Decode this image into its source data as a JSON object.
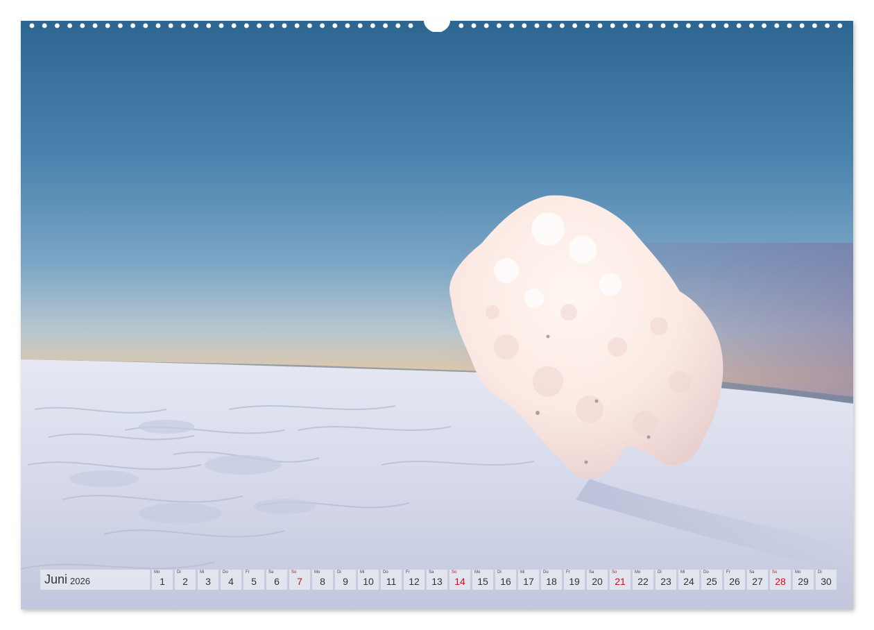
{
  "calendar": {
    "month": "Juni",
    "year": "2026",
    "sunday_color": "#c0111b",
    "days": [
      {
        "abbr": "Mo",
        "num": "1",
        "sunday": false
      },
      {
        "abbr": "Di",
        "num": "2",
        "sunday": false
      },
      {
        "abbr": "Mi",
        "num": "3",
        "sunday": false
      },
      {
        "abbr": "Do",
        "num": "4",
        "sunday": false
      },
      {
        "abbr": "Fr",
        "num": "5",
        "sunday": false
      },
      {
        "abbr": "Sa",
        "num": "6",
        "sunday": false
      },
      {
        "abbr": "So",
        "num": "7",
        "sunday": true
      },
      {
        "abbr": "Mo",
        "num": "8",
        "sunday": false
      },
      {
        "abbr": "Di",
        "num": "9",
        "sunday": false
      },
      {
        "abbr": "Mi",
        "num": "10",
        "sunday": false
      },
      {
        "abbr": "Do",
        "num": "11",
        "sunday": false
      },
      {
        "abbr": "Fr",
        "num": "12",
        "sunday": false
      },
      {
        "abbr": "Sa",
        "num": "13",
        "sunday": false
      },
      {
        "abbr": "So",
        "num": "14",
        "sunday": true
      },
      {
        "abbr": "Mo",
        "num": "15",
        "sunday": false
      },
      {
        "abbr": "Di",
        "num": "16",
        "sunday": false
      },
      {
        "abbr": "Mi",
        "num": "17",
        "sunday": false
      },
      {
        "abbr": "Do",
        "num": "18",
        "sunday": false
      },
      {
        "abbr": "Fr",
        "num": "19",
        "sunday": false
      },
      {
        "abbr": "Sa",
        "num": "20",
        "sunday": false
      },
      {
        "abbr": "So",
        "num": "21",
        "sunday": true
      },
      {
        "abbr": "Mo",
        "num": "22",
        "sunday": false
      },
      {
        "abbr": "Di",
        "num": "23",
        "sunday": false
      },
      {
        "abbr": "Mi",
        "num": "24",
        "sunday": false
      },
      {
        "abbr": "Do",
        "num": "25",
        "sunday": false
      },
      {
        "abbr": "Fr",
        "num": "26",
        "sunday": false
      },
      {
        "abbr": "Sa",
        "num": "27",
        "sunday": false
      },
      {
        "abbr": "So",
        "num": "28",
        "sunday": true
      },
      {
        "abbr": "Mo",
        "num": "29",
        "sunday": false
      },
      {
        "abbr": "Di",
        "num": "30",
        "sunday": false
      }
    ]
  },
  "photo": {
    "sky_top_color": "#2e6590",
    "sky_horizon_color": "#e8bf98",
    "snow_color": "#dfe4f1",
    "icon": "snow-covered-tree-photo"
  }
}
